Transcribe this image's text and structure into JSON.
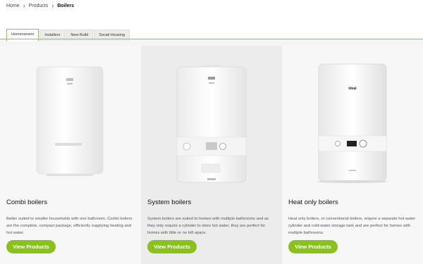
{
  "breadcrumb": {
    "items": [
      "Home",
      "Products",
      "Boilers"
    ]
  },
  "tabs": [
    {
      "label": "Homeowners",
      "active": true
    },
    {
      "label": "Installers",
      "active": false
    },
    {
      "label": "New Build",
      "active": false
    },
    {
      "label": "Social Housing",
      "active": false
    }
  ],
  "products": [
    {
      "title": "Combi boilers",
      "description": "Better suited to smaller households with one bathroom, Combi boilers are the complete, compact package, efficiently supplying heating and hot water.",
      "button_label": "View Products",
      "brand": "ideal"
    },
    {
      "title": "System boilers",
      "description": "System boilers are suited to homes with multiple bathrooms and as they only require a cylinder to store hot water, they are perfect for homes with little or no loft space.",
      "button_label": "View Products",
      "brand": "ideal"
    },
    {
      "title": "Heat only boilers",
      "description": "Heat only boilers, or conventional boilers, require a separate hot water cylinder and cold-water storage tank and are perfect for homes with multiple bathrooms.",
      "button_label": "View Products",
      "brand": "ideal",
      "sub_brand": "LOGIC+"
    }
  ],
  "colors": {
    "accent": "#8bc11e",
    "tab_line": "#8dc63f"
  }
}
